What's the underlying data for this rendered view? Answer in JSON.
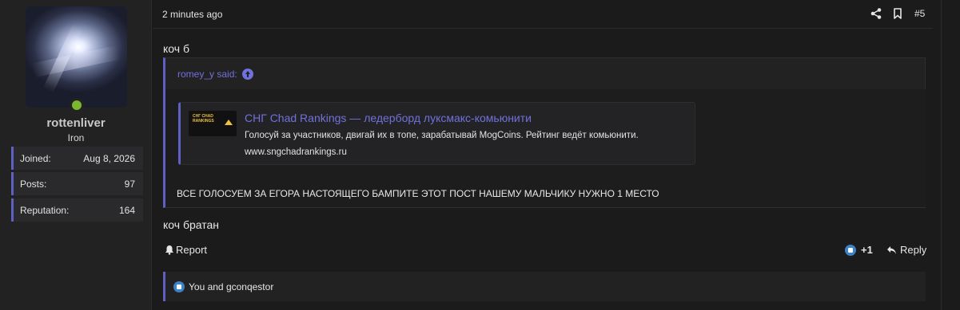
{
  "user": {
    "username": "rottenliver",
    "rank": "Iron",
    "online_color": "#7cb82f",
    "stats": [
      {
        "label": "Joined:",
        "value": "Aug 8, 2026"
      },
      {
        "label": "Posts:",
        "value": "97"
      },
      {
        "label": "Reputation:",
        "value": "164"
      }
    ]
  },
  "post": {
    "timestamp": "2 minutes ago",
    "number": "#5",
    "icons": [
      "share-icon",
      "bookmark-icon"
    ],
    "text_before": "коч б",
    "text_after": "коч братан"
  },
  "quote": {
    "author": "romey_y said:",
    "embed": {
      "thumb_line1": "СНГ CHAD",
      "thumb_line2": "RANKINGS",
      "title": "СНГ Chad Rankings — ледерборд луксмакс-комьюнити",
      "description": "Голосуй за участников, двигай их в топе, зарабатывай MogCoins. Рейтинг ведёт комьюнити.",
      "url": "www.sngchadrankings.ru"
    },
    "text": "ВСЕ ГОЛОСУЕМ ЗА ЕГОРА НАСТОЯЩЕГО БАМПИТЕ ЭТОТ ПОСТ НАШЕМУ МАЛЬЧИКУ НУЖНО 1 МЕСТО"
  },
  "actions": {
    "report_label": "Report",
    "like_count": "+1",
    "reply_label": "Reply"
  },
  "reactions": {
    "text": "You and gconqestor"
  },
  "colors": {
    "accent": "#5f5fc4",
    "link": "#7171dd",
    "background": "#1b1b1c"
  }
}
